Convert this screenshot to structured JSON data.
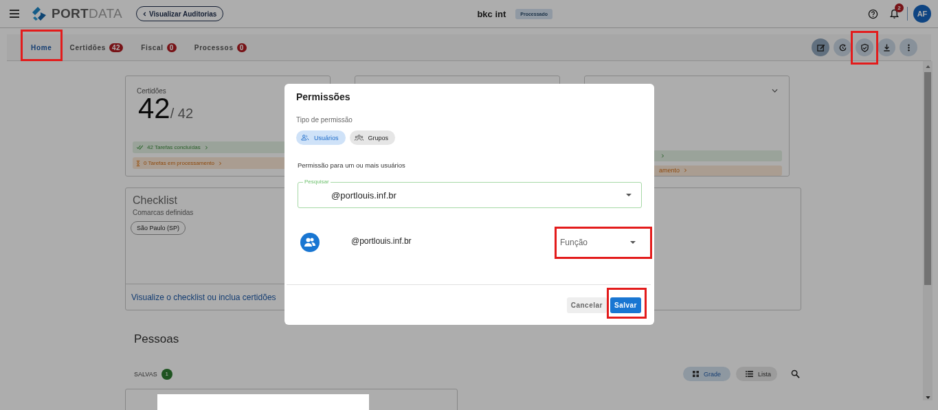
{
  "header": {
    "brand_strong": "PORT",
    "brand_light": "DATA",
    "back_button": "Visualizar Auditorias",
    "title": "bkc int",
    "status_badge": "Processado",
    "notification_count": "2",
    "avatar_initials": "AF"
  },
  "tabs": [
    {
      "label": "Home",
      "selected": true
    },
    {
      "label": "Certidões",
      "count": "42",
      "selected": false
    },
    {
      "label": "Fiscal",
      "count": "0",
      "selected": false
    },
    {
      "label": "Processos",
      "count": "0",
      "selected": false
    }
  ],
  "summary_cards": [
    {
      "kind": "full",
      "title": "Certidões",
      "value": "42",
      "total": "/ 42",
      "done": "42 Tarefas concluídas",
      "processing": "0 Tarefas em processamento"
    },
    {
      "kind": "blank"
    },
    {
      "kind": "partial",
      "processing_tail": "amento"
    }
  ],
  "checklist": {
    "title": "Checklist",
    "subtitle": "Comarcas definidas",
    "chips": [
      "São Paulo (SP)"
    ],
    "link": "Visualize o checklist ou inclua certidões"
  },
  "people": {
    "title": "Pessoas",
    "saved_label": "SALVAS",
    "saved_count": "1",
    "views": [
      {
        "label": "Grade",
        "kind": "grid",
        "selected": true
      },
      {
        "label": "Lista",
        "kind": "list",
        "selected": false
      }
    ]
  },
  "dialog": {
    "title": "Permissões",
    "type_label": "Tipo de permissão",
    "types": [
      {
        "label": "Usuários",
        "kind": "users",
        "selected": true
      },
      {
        "label": "Grupos",
        "kind": "groups",
        "selected": false
      }
    ],
    "description": "Permissão para um ou mais usuários",
    "search": {
      "label": "Pesquisar",
      "value": "@portlouis.inf.br"
    },
    "entries": [
      {
        "email": "@portlouis.inf.br",
        "role_placeholder": "Função"
      }
    ],
    "buttons": [
      {
        "label": "Cancelar",
        "kind": "secondary"
      },
      {
        "label": "Salvar",
        "kind": "primary"
      }
    ]
  }
}
